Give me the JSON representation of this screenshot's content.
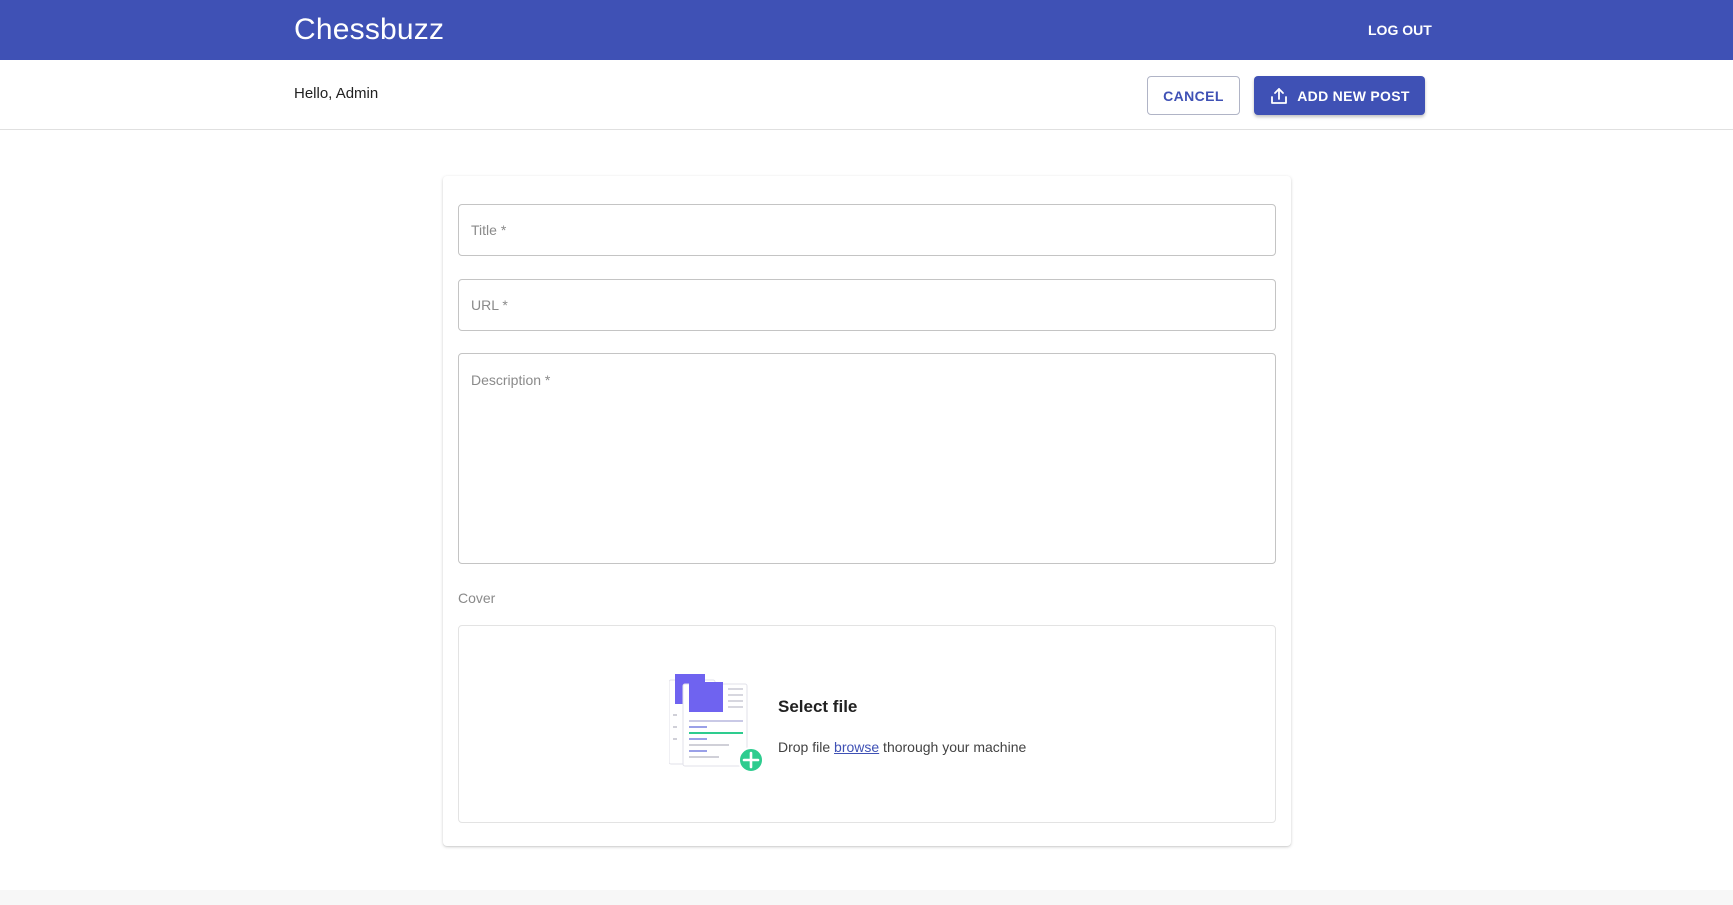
{
  "header": {
    "brand": "Chessbuzz",
    "logout_label": "LOG OUT"
  },
  "subheader": {
    "greeting": "Hello, Admin",
    "cancel_label": "CANCEL",
    "add_label": "ADD NEW POST"
  },
  "form": {
    "title_placeholder": "Title *",
    "url_placeholder": "URL *",
    "description_placeholder": "Description *",
    "title_value": "",
    "url_value": "",
    "description_value": ""
  },
  "cover": {
    "label": "Cover",
    "dropzone_title": "Select file",
    "dropzone_text_before": "Drop file ",
    "dropzone_link": "browse",
    "dropzone_text_after": " thorough your machine"
  },
  "colors": {
    "primary": "#3f51b5",
    "accent_green": "#2ecc8f",
    "illustration_purple": "#6f63f0"
  },
  "icons": {
    "add_button_icon": "upload-icon",
    "dropzone_icon": "file-upload-illustration-icon"
  }
}
